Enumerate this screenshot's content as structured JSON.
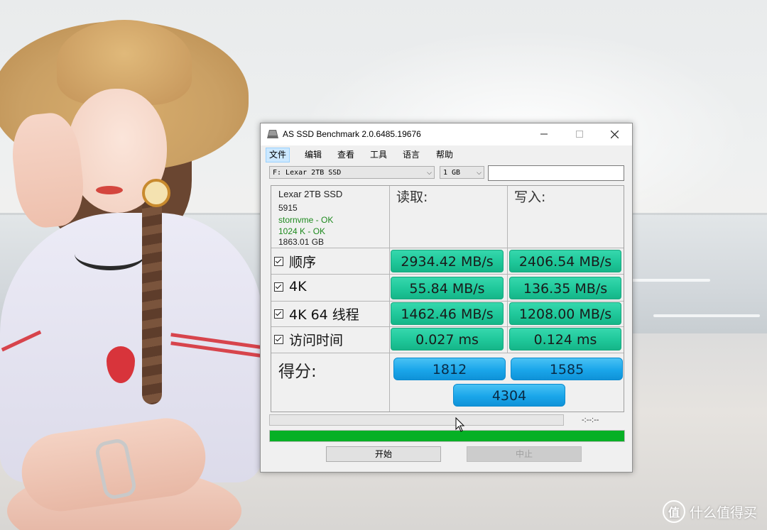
{
  "window": {
    "title": "AS SSD Benchmark 2.0.6485.19676",
    "controls": {
      "minimize": "—",
      "maximize": "☐",
      "close": "✕"
    }
  },
  "menu": [
    "文件",
    "编辑",
    "查看",
    "工具",
    "语言",
    "帮助"
  ],
  "menu_active_index": 0,
  "drive_select": {
    "value": "F: Lexar 2TB SSD"
  },
  "size_select": {
    "value": "1 GB"
  },
  "drive_info": {
    "name": "Lexar 2TB SSD",
    "firmware": "5915",
    "driver": "stornvme - OK",
    "alignment": "1024 K - OK",
    "capacity": "1863.01 GB"
  },
  "columns": {
    "read": "读取:",
    "write": "写入:"
  },
  "tests": [
    {
      "label": "顺序",
      "read": "2934.42 MB/s",
      "write": "2406.54 MB/s",
      "checked": true
    },
    {
      "label": "4K",
      "read": "55.84 MB/s",
      "write": "136.35 MB/s",
      "checked": true
    },
    {
      "label": "4K 64 线程",
      "read": "1462.46 MB/s",
      "write": "1208.00 MB/s",
      "checked": true
    },
    {
      "label": "访问时间",
      "read": "0.027 ms",
      "write": "0.124 ms",
      "checked": true
    }
  ],
  "score": {
    "label": "得分:",
    "read": "1812",
    "write": "1585",
    "total": "4304"
  },
  "progress": {
    "time_text": "-:--:--",
    "overall_fill": 1.0
  },
  "buttons": {
    "start": "开始",
    "abort": "中止"
  },
  "watermark": {
    "badge": "值",
    "text": "什么值得买"
  },
  "colors": {
    "result_green": "#1fc79a",
    "score_blue": "#1aa6ea",
    "progress_green": "#06b025"
  }
}
